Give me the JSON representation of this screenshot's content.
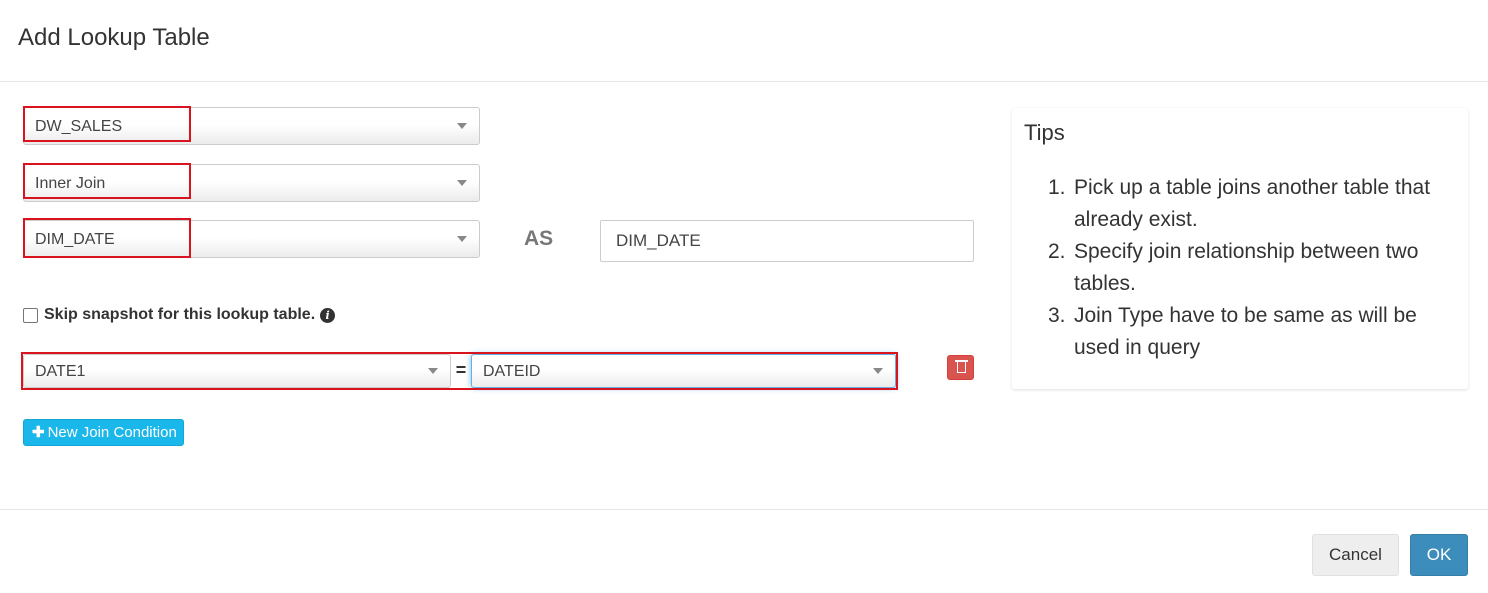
{
  "modal": {
    "title": "Add Lookup Table"
  },
  "form": {
    "source_table": "DW_SALES",
    "join_type": "Inner Join",
    "lookup_table": "DIM_DATE",
    "as_label": "AS",
    "alias_value": "DIM_DATE",
    "skip_snapshot_label": "Skip snapshot for this lookup table.",
    "skip_snapshot_checked": false
  },
  "join_conditions": [
    {
      "left_column": "DATE1",
      "operator": "=",
      "right_column": "DATEID"
    }
  ],
  "buttons": {
    "new_join_condition": "New Join Condition",
    "cancel": "Cancel",
    "ok": "OK"
  },
  "tips": {
    "title": "Tips",
    "items": [
      {
        "num": "1.",
        "text": "Pick up a table joins another table that already exist."
      },
      {
        "num": "2.",
        "text": "Specify join relationship between two tables."
      },
      {
        "num": "3.",
        "text": "Join Type have to be same as will be used in query"
      }
    ]
  },
  "colors": {
    "highlight": "#d9141e",
    "new_join_button": "#1ab7ea",
    "delete_button": "#d9534f",
    "ok_button": "#3c8dbc"
  },
  "icons": {
    "info": "info-circle-icon",
    "delete": "trash-icon",
    "add": "plus-icon",
    "dropdown": "caret-down-icon"
  }
}
